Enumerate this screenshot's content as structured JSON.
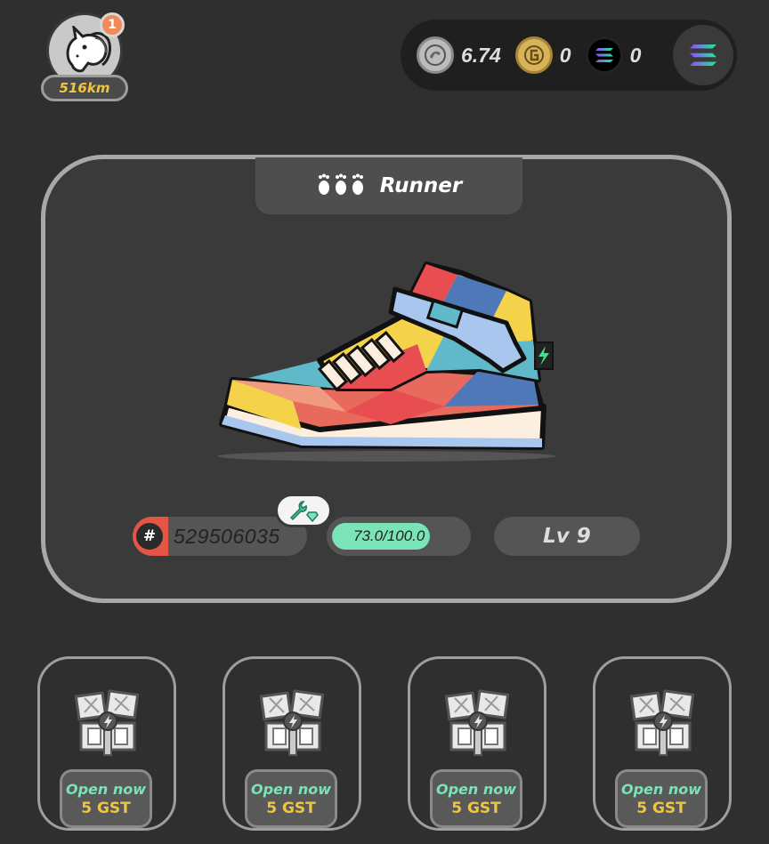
{
  "profile": {
    "badge_count": "1",
    "distance": "516km"
  },
  "balances": {
    "gmt": "6.74",
    "gst": "0",
    "sol": "0"
  },
  "sneaker": {
    "type": "Runner",
    "id_value": "529506035",
    "durability_text": "73.0/100.0",
    "durability": 0.73,
    "level": "Lv 9"
  },
  "boxes": [
    {
      "action": "Open now",
      "price": "5 GST"
    },
    {
      "action": "Open now",
      "price": "5 GST"
    },
    {
      "action": "Open now",
      "price": "5 GST"
    },
    {
      "action": "Open now",
      "price": "5 GST"
    }
  ],
  "colors": {
    "background": "#2f2f2f",
    "accent_green": "#7be3b8",
    "accent_gold": "#f0c540",
    "id_red": "#e55545"
  },
  "icons": [
    "unicorn-avatar-icon",
    "gmt-coin-icon",
    "gst-coin-icon",
    "sol-coin-icon",
    "solana-wallet-icon",
    "footprints-icon",
    "wrench-gem-icon",
    "mystery-box-icon"
  ]
}
